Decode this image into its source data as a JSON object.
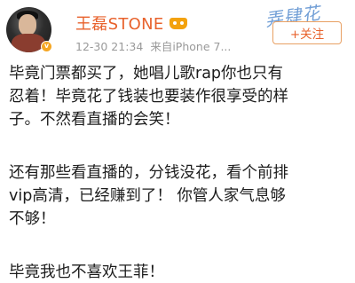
{
  "post": {
    "author": "王磊STONE",
    "timestamp": "12-30 21:34",
    "source": "来自iPhone 7...",
    "follow_label": "+关注",
    "watermark": "弄肆花",
    "paragraphs": [
      {
        "lines": [
          "毕竟门票都买了，她唱儿歌rap你也只有",
          "忍着！毕竟花了钱装也要装作很享受的样",
          "子。不然看直播的会笑！"
        ]
      },
      {
        "lines": [
          "还有那些看直播的，分钱没花，看个前排",
          "vip高清，已经赚到了！ 你管人家气息够",
          "不够！"
        ]
      },
      {
        "lines": [
          "毕竟我也不喜欢王菲！"
        ]
      }
    ]
  },
  "colors": {
    "username": "#e8622c",
    "follow_border": "#e8a063",
    "meta": "#9a9a9a",
    "body_text": "#1c1c1c",
    "vip_badge": "#f3a20d"
  },
  "icons": {
    "vip": "crown-vip-icon",
    "verified": "verified-badge-icon"
  }
}
